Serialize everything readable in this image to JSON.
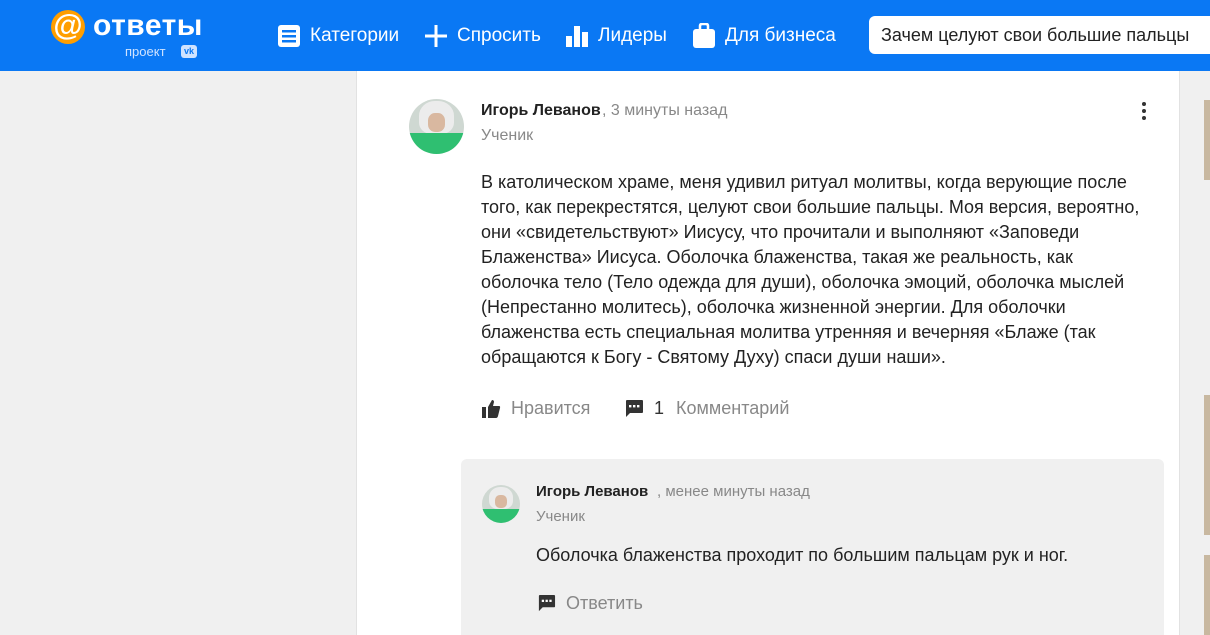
{
  "header": {
    "logo_text": "ответы",
    "logo_sub": "проект",
    "logo_badge": "vk",
    "nav": [
      {
        "label": "Категории",
        "icon": "list-icon"
      },
      {
        "label": "Спросить",
        "icon": "plus-icon"
      },
      {
        "label": "Лидеры",
        "icon": "bar-chart-icon"
      },
      {
        "label": "Для бизнеса",
        "icon": "briefcase-icon"
      }
    ],
    "search_value": "Зачем целуют свои большие пальцы"
  },
  "answer": {
    "author": "Игорь Леванов",
    "time": ", 3 минуты назад",
    "rank": "Ученик",
    "text": "В католическом храме, меня удивил ритуал молитвы, когда верующие после того, как перекрестятся, целуют свои большие пальцы. Моя версия, вероятно, они «свидетельствуют» Иисусу, что прочитали и выполняют «Заповеди Блаженства» Иисуса.  Оболочка блаженства, такая же реальность, как оболочка тело (Тело одежда для души), оболочка эмоций, оболочка мыслей (Непрестанно молитесь), оболочка жизненной энергии. Для оболочки блаженства есть специальная молитва утренняя и вечерняя «Блаже (так обращаются к Богу - Святому Духу) спаси души наши».",
    "like_label": "Нравится",
    "comment_count": "1",
    "comment_label": "Комментарий"
  },
  "comment": {
    "author": "Игорь Леванов",
    "time": ", менее минуты назад",
    "rank": "Ученик",
    "text": "Оболочка блаженства проходит по большим пальцам рук и ног.",
    "reply_label": "Ответить"
  },
  "colors": {
    "header_bg": "#0a78f4",
    "logo_accent": "#ff9e00",
    "card_bg": "#ffffff",
    "page_bg": "#f0f0f0",
    "muted_text": "#888888"
  }
}
